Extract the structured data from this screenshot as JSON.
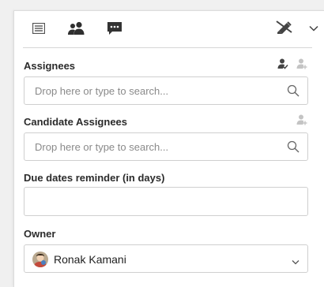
{
  "tabs": [
    {
      "name": "details",
      "icon": "list-icon",
      "active": false
    },
    {
      "name": "assignments",
      "icon": "people-icon",
      "active": true
    },
    {
      "name": "comments",
      "icon": "chat-icon",
      "active": false
    }
  ],
  "toolbar": {
    "right_icons": [
      "edit-disabled-icon",
      "chevron-down-icon"
    ]
  },
  "assignees": {
    "label": "Assignees",
    "placeholder": "Drop here or type to search..."
  },
  "candidate_assignees": {
    "label": "Candidate Assignees",
    "placeholder": "Drop here or type to search..."
  },
  "due_dates": {
    "label": "Due dates reminder (in days)",
    "value": ""
  },
  "owner": {
    "label": "Owner",
    "name": "Ronak Kamani"
  },
  "colors": {
    "accent": "#3a3a3a",
    "icon_muted": "#b8b8b8",
    "border": "#cfcfcf"
  }
}
